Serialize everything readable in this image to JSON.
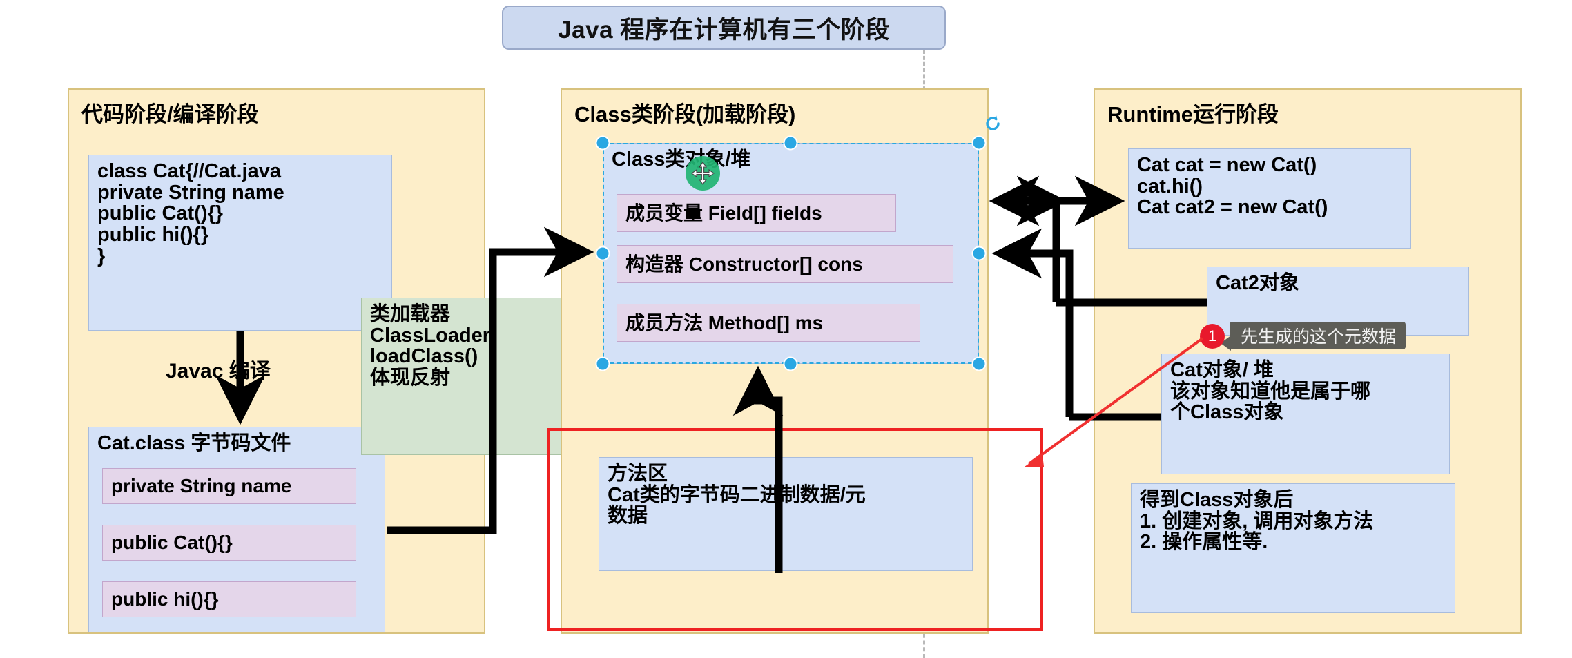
{
  "title": {
    "text": "Java 程序在计算机有三个阶段"
  },
  "stages": {
    "code": {
      "title": "代码阶段/编译阶段",
      "source_box": "class Cat{//Cat.java\nprivate String name\npublic Cat(){}\npublic hi(){}\n}",
      "compile_label": "Javac 编译",
      "class_file": {
        "title": "Cat.class 字节码文件",
        "members": [
          "private String name",
          "public Cat(){}",
          "public hi(){}"
        ]
      }
    },
    "classloader": {
      "text": "类加载器\nClassLoader\nloadClass()\n体现反射"
    },
    "classstage": {
      "title": "Class类阶段(加载阶段)",
      "object_title": "Class类对象/堆",
      "members": [
        "成员变量 Field[] fields",
        "构造器 Constructor[] cons",
        "成员方法 Method[] ms"
      ],
      "method_area": "方法区\nCat类的字节码二进制数据/元\n数据"
    },
    "runtime": {
      "title": "Runtime运行阶段",
      "code_box": "Cat cat = new Cat()\ncat.hi()\nCat cat2 = new Cat()",
      "cat2_object": "Cat2对象",
      "cat_object": "Cat对象/ 堆\n该对象知道他是属于哪\n个Class对象",
      "after_class": "得到Class对象后\n1. 创建对象, 调用对象方法\n2. 操作属性等."
    }
  },
  "annotation": {
    "badge_number": "1",
    "tooltip_text": "先生成的这个元数据"
  },
  "colors": {
    "panel_bg": "#fdeec9",
    "panel_border": "#d8c27e",
    "blue_box": "#d4e1f7",
    "pink_box": "#e4d6ea",
    "green_box": "#d4e4d1",
    "title_box": "#ccd9f0",
    "selection": "#2aa7e3",
    "highlight_rect": "#ee2222",
    "badge": "#e8192c",
    "tooltip_bg": "#5d5d57",
    "cursor_green": "#22b573"
  }
}
